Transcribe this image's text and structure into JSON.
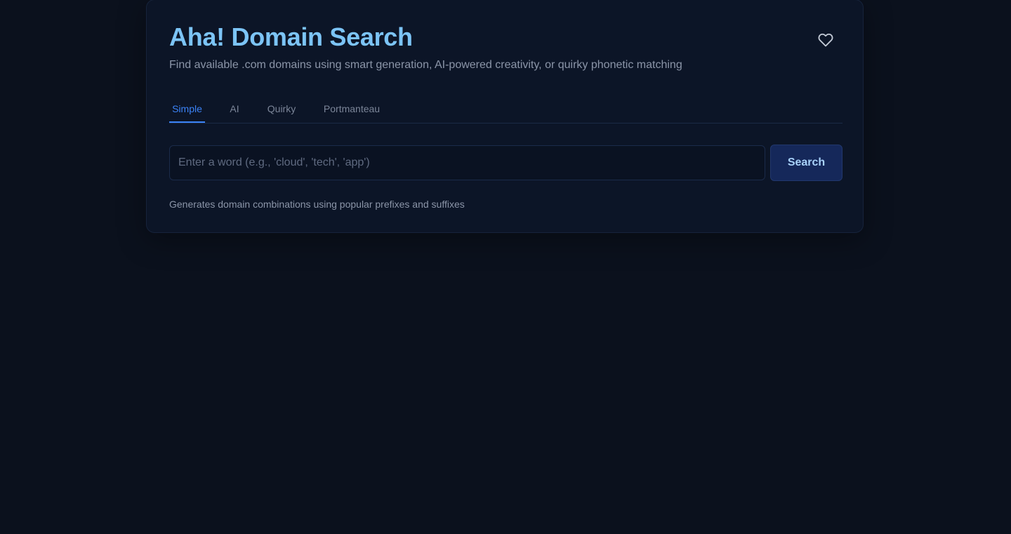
{
  "header": {
    "title": "Aha! Domain Search",
    "subtitle": "Find available .com domains using smart generation, AI-powered creativity, or quirky phonetic matching",
    "favorite_icon": "heart-icon"
  },
  "tabs": [
    {
      "label": "Simple",
      "active": true
    },
    {
      "label": "AI",
      "active": false
    },
    {
      "label": "Quirky",
      "active": false
    },
    {
      "label": "Portmanteau",
      "active": false
    }
  ],
  "search": {
    "value": "",
    "placeholder": "Enter a word (e.g., 'cloud', 'tech', 'app')",
    "button_label": "Search"
  },
  "help_text": "Generates domain combinations using popular prefixes and suffixes",
  "colors": {
    "background": "#0b111d",
    "card": "#0c1527",
    "accent": "#3b82f6",
    "title": "#7cc4f6"
  }
}
